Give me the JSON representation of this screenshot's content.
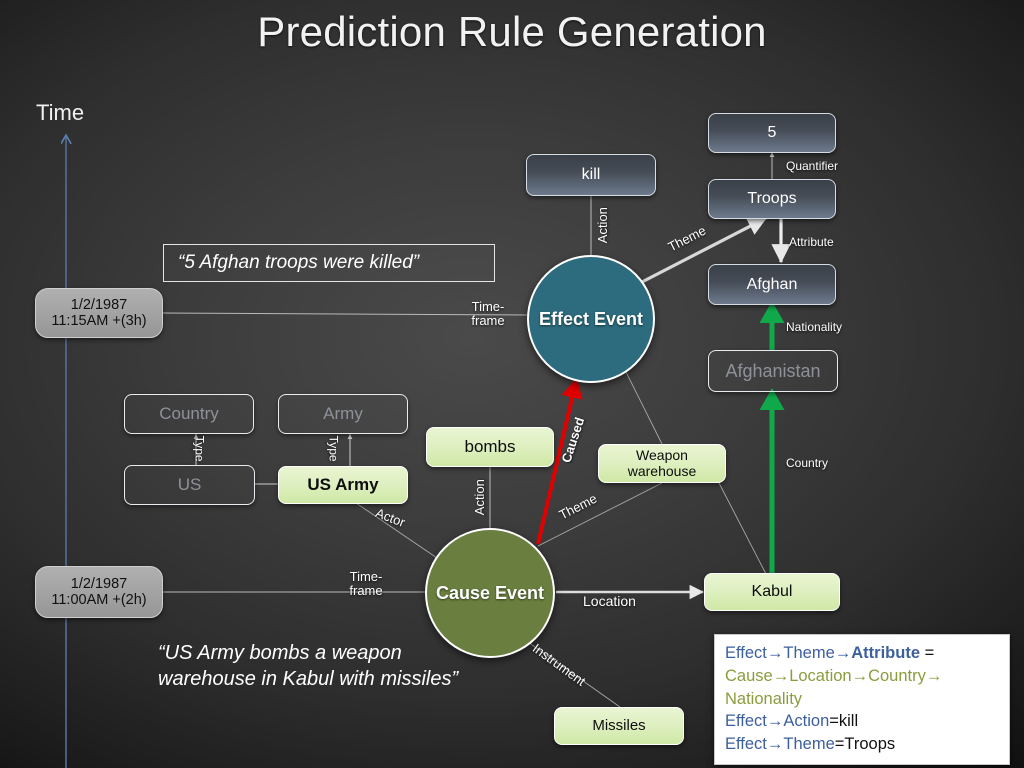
{
  "title": "Prediction Rule Generation",
  "axis": {
    "label": "Time"
  },
  "quotes": {
    "effect": "“5 Afghan troops were killed”",
    "cause": "“US Army bombs a weapon\nwarehouse in Kabul with missiles”"
  },
  "events": {
    "effect": "Effect\nEvent",
    "cause": "Cause\nEvent"
  },
  "timestamps": {
    "effect": "1/2/1987\n11:15AM +(3h)",
    "cause": "1/2/1987\n11:00AM +(2h)"
  },
  "nodes": {
    "five": "5",
    "troops": "Troops",
    "afghan": "Afghan",
    "afghanistan": "Afghanistan",
    "kill": "kill",
    "country": "Country",
    "army": "Army",
    "us": "US",
    "us_army": "US Army",
    "bombs": "bombs",
    "weapon_warehouse": "Weapon\nwarehouse",
    "kabul": "Kabul",
    "missiles": "Missiles"
  },
  "edge_labels": {
    "quantifier": "Quantifier",
    "attribute": "Attribute",
    "nationality": "Nationality",
    "country": "Country",
    "action_effect": "Action",
    "theme_effect": "Theme",
    "timeframe_effect": "Time-\nframe",
    "timeframe_cause": "Time-\nframe",
    "caused": "Caused",
    "action_cause": "Action",
    "theme_cause": "Theme",
    "location": "Location",
    "instrument": "Instrument",
    "actor": "Actor",
    "type_us": "Type",
    "type_army": "Type"
  },
  "legend": {
    "line1": {
      "a": "Effect",
      "b": "Theme",
      "c": "Attribute",
      "tail": " ="
    },
    "line2": {
      "a": "Cause",
      "b": "Location",
      "c": "Country"
    },
    "line3": {
      "a": "Nationality"
    },
    "line4": {
      "a": "Effect",
      "b": "Action",
      "value": "=kill"
    },
    "line5": {
      "a": "Effect",
      "b": "Theme",
      "value": "=Troops"
    },
    "arrow": "→"
  },
  "colors": {
    "effect_event": "#2c6c7e",
    "cause_event": "#6a7f3f",
    "caused_arrow": "#e00000",
    "green_arrow": "#10a94a",
    "time_axis": "#4f6f9c",
    "legend_blue": "#3c5f9e",
    "legend_olive": "#8d9b3d"
  }
}
